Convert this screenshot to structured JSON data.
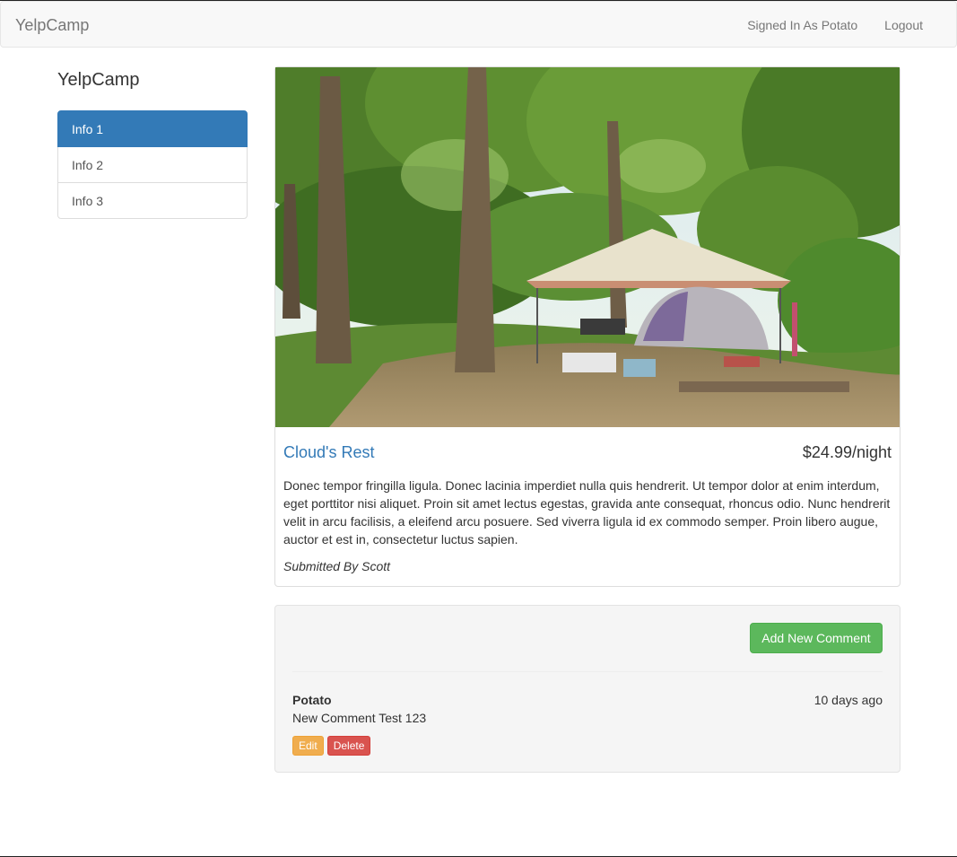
{
  "navbar": {
    "brand": "YelpCamp",
    "signed_in": "Signed In As Potato",
    "logout": "Logout"
  },
  "sidebar": {
    "title": "YelpCamp",
    "items": [
      {
        "label": "Info 1",
        "active": true
      },
      {
        "label": "Info 2",
        "active": false
      },
      {
        "label": "Info 3",
        "active": false
      }
    ]
  },
  "campground": {
    "name": "Cloud's Rest",
    "price": "$24.99/night",
    "description": "Donec tempor fringilla ligula. Donec lacinia imperdiet nulla quis hendrerit. Ut tempor dolor at enim interdum, eget porttitor nisi aliquet. Proin sit amet lectus egestas, gravida ante consequat, rhoncus odio. Nunc hendrerit velit in arcu facilisis, a eleifend arcu posuere. Sed viverra ligula id ex commodo semper. Proin libero augue, auctor et est in, consectetur luctus sapien.",
    "submitted_by": "Submitted By Scott",
    "image_icon": "campsite-photo"
  },
  "comments": {
    "add_button": "Add New Comment",
    "items": [
      {
        "author": "Potato",
        "time": "10 days ago",
        "text": "New Comment Test 123",
        "edit_label": "Edit",
        "delete_label": "Delete"
      }
    ]
  },
  "colors": {
    "primary": "#337ab7",
    "success": "#5cb85c",
    "warning": "#f0ad4e",
    "danger": "#d9534f"
  }
}
